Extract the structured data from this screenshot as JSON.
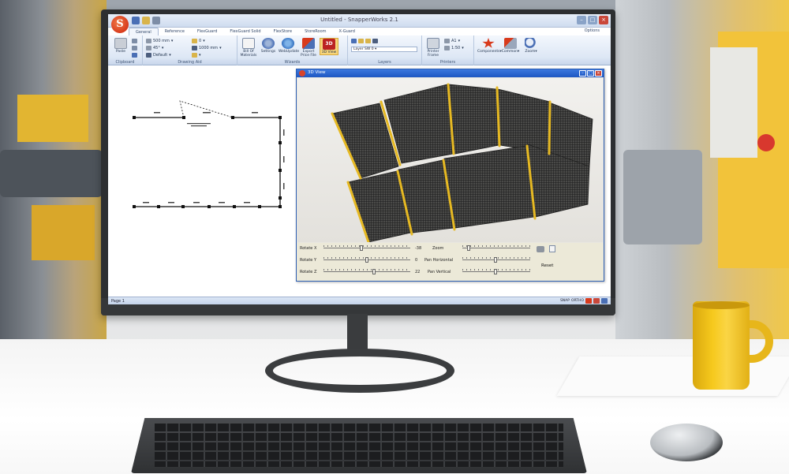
{
  "window": {
    "title": "Untitled - SnapperWorks 2.1"
  },
  "ribbon": {
    "tabs": [
      "General",
      "Reference",
      "FlexGuard",
      "FlexGuard Solid",
      "FlexStore",
      "StoreRoom",
      "X-Guard"
    ],
    "active_tab": "General",
    "right_menu": "Options",
    "groups": {
      "clipboard": {
        "label": "Clipboard",
        "paste": "Paste"
      },
      "drawing_aid": {
        "label": "Drawing Aid",
        "length": "500 mm",
        "angle": "45°",
        "style": "Default",
        "height": "1000 mm"
      },
      "wizards": {
        "label": "Wizards",
        "bill_of_materials": "Bill Of Materials",
        "settings": "Settings",
        "web_update": "WebUpdate",
        "export_price_file": "Export Price File",
        "view_3d": "3D View"
      },
      "layers": {
        "label": "Layers",
        "layer": "Layer SW 0"
      },
      "printers": {
        "label": "Printers",
        "printer_frame": "Printer Frame",
        "page_size": "A1",
        "scale": "1:50"
      },
      "tools": {
        "components": "Components",
        "common": "Common",
        "zoom": "Zoom"
      }
    }
  },
  "view3d": {
    "title": "3D View",
    "controls": {
      "rotate_x": {
        "label": "Rotate X",
        "value": "-38"
      },
      "rotate_y": {
        "label": "Rotate Y",
        "value": "0"
      },
      "rotate_z": {
        "label": "Rotate Z",
        "value": "22"
      },
      "zoom": {
        "label": "Zoom"
      },
      "pan_horizontal": {
        "label": "Pan Horizontal"
      },
      "pan_vertical": {
        "label": "Pan Vertical"
      },
      "reset": "Reset"
    }
  },
  "status": {
    "page": "Page 1",
    "snap": "SNAP",
    "ortho": "ORTHO"
  },
  "colors": {
    "accent_red": "#d83a1c",
    "ribbon_blue": "#dde7f5",
    "post_yellow": "#e6b923",
    "mesh_dark": "#2a2a2a"
  }
}
